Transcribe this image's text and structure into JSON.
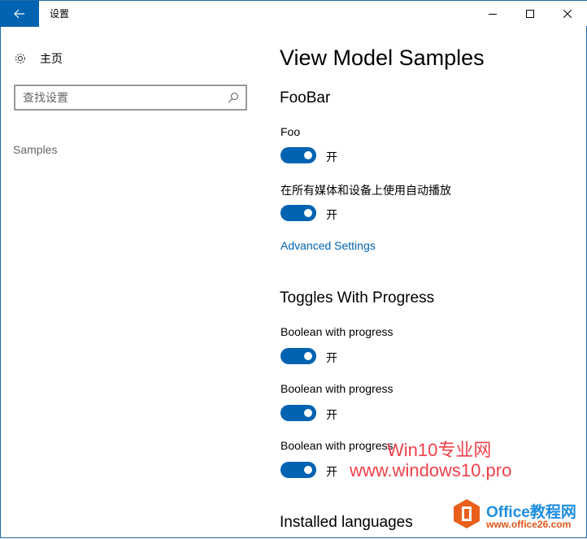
{
  "window": {
    "title": "设置",
    "back_icon": "arrow-left-icon",
    "controls": {
      "minimize": "minimize-icon",
      "maximize": "maximize-icon",
      "close": "close-icon"
    }
  },
  "sidebar": {
    "home_label": "主页",
    "home_icon": "gear-icon",
    "search_placeholder": "查找设置",
    "search_icon": "search-icon",
    "items": [
      {
        "label": "Samples"
      }
    ]
  },
  "main": {
    "title": "View Model Samples",
    "sections": [
      {
        "title": "FooBar",
        "toggles": [
          {
            "label": "Foo",
            "state": "开",
            "on": true
          },
          {
            "label": "在所有媒体和设备上使用自动播放",
            "state": "开",
            "on": true
          }
        ],
        "link": "Advanced Settings"
      },
      {
        "title": "Toggles With Progress",
        "toggles": [
          {
            "label": "Boolean with progress",
            "state": "开",
            "on": true
          },
          {
            "label": "Boolean with progress",
            "state": "开",
            "on": true
          },
          {
            "label": "Boolean with progress",
            "state": "开",
            "on": true
          }
        ]
      },
      {
        "title": "Installed languages"
      }
    ]
  },
  "watermarks": {
    "line1": "Win10专业网",
    "line2": "www.windows10.pro",
    "logo_title": "Office教程网",
    "logo_url": "www.office26.com"
  },
  "colors": {
    "accent": "#0063b1",
    "watermark": "#f0404a"
  }
}
